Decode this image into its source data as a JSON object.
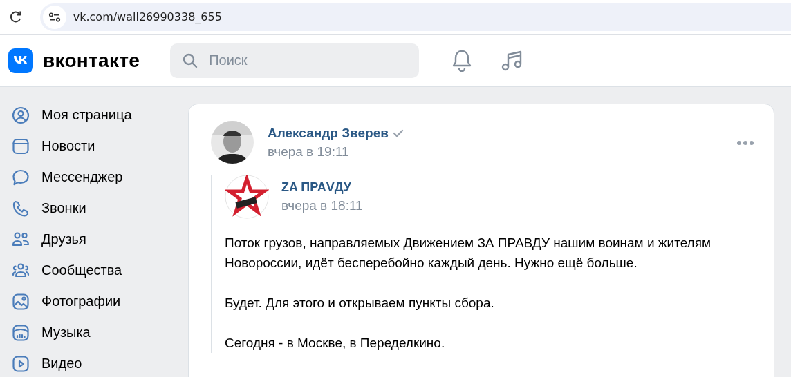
{
  "browser": {
    "url": "vk.com/wall26990338_655"
  },
  "header": {
    "logo_text": "вконтакте",
    "search": {
      "placeholder": "Поиск"
    }
  },
  "sidebar": {
    "items": [
      {
        "label": "Моя страница"
      },
      {
        "label": "Новости"
      },
      {
        "label": "Мессенджер"
      },
      {
        "label": "Звонки"
      },
      {
        "label": "Друзья"
      },
      {
        "label": "Сообщества"
      },
      {
        "label": "Фотографии"
      },
      {
        "label": "Музыка"
      },
      {
        "label": "Видео"
      }
    ]
  },
  "post": {
    "author": "Александр Зверев",
    "verified": true,
    "time": "вчера в 19:11",
    "repost": {
      "author": "ZA ПРАVДУ",
      "time": "вчера в 18:11",
      "paragraphs": [
        "Поток грузов, направляемых Движением ЗА ПРАВДУ нашим воинам и жителям Новороссии, идёт бесперебойно каждый день. Нужно ещё больше.",
        "Будет. Для этого и открываем пункты сбора.",
        "Сегодня - в Москве, в Переделкино."
      ]
    }
  }
}
